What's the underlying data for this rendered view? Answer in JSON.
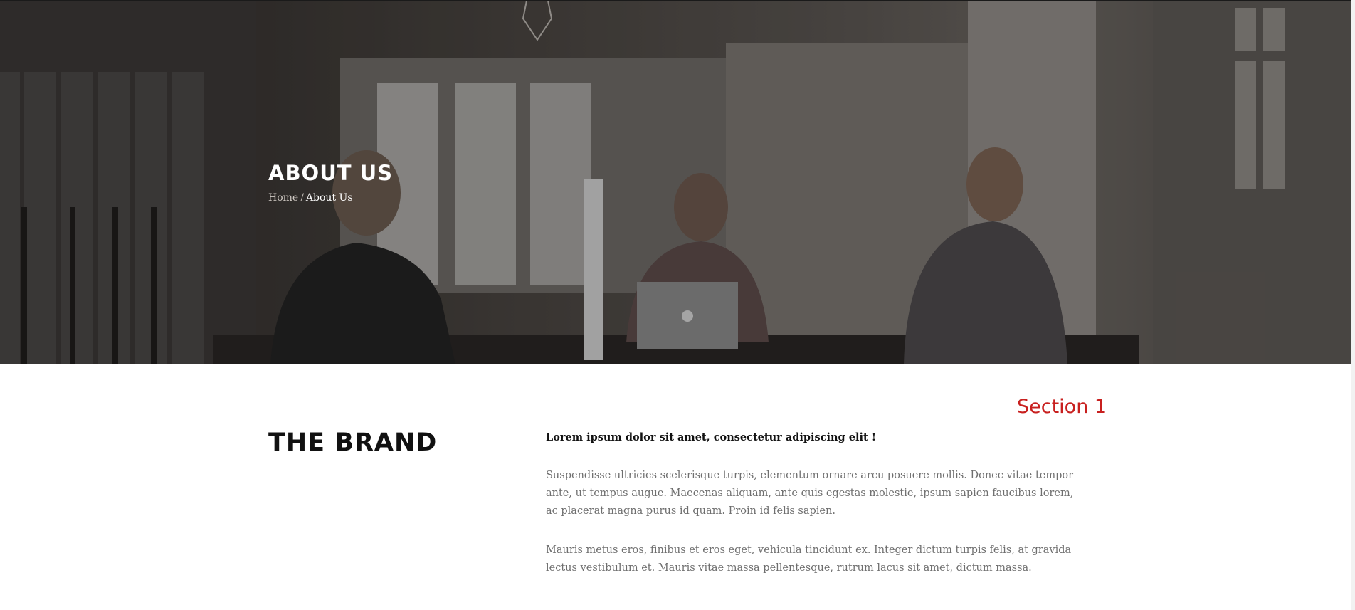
{
  "hero": {
    "title": "ABOUT US",
    "breadcrumb": {
      "home": "Home",
      "separator": "/",
      "current": "About Us"
    },
    "image": "office-workspace-photo"
  },
  "annotation": {
    "label": "Section 1",
    "color": "#c8201f"
  },
  "brand_section": {
    "title": "THE BRAND",
    "lead": "Lorem ipsum dolor sit amet, consectetur adipiscing elit !",
    "paragraphs": [
      "Suspendisse ultricies scelerisque turpis, elementum ornare arcu posuere mollis. Donec vitae tempor ante, ut tempus augue. Maecenas aliquam, ante quis egestas molestie, ipsum sapien faucibus lorem, ac placerat magna purus id quam. Proin id felis sapien.",
      "Mauris metus eros, finibus et eros eget, vehicula tincidunt ex. Integer dictum turpis felis, at gravida lectus vestibulum et. Mauris vitae massa pellentesque, rutrum lacus sit amet, dictum massa."
    ]
  }
}
